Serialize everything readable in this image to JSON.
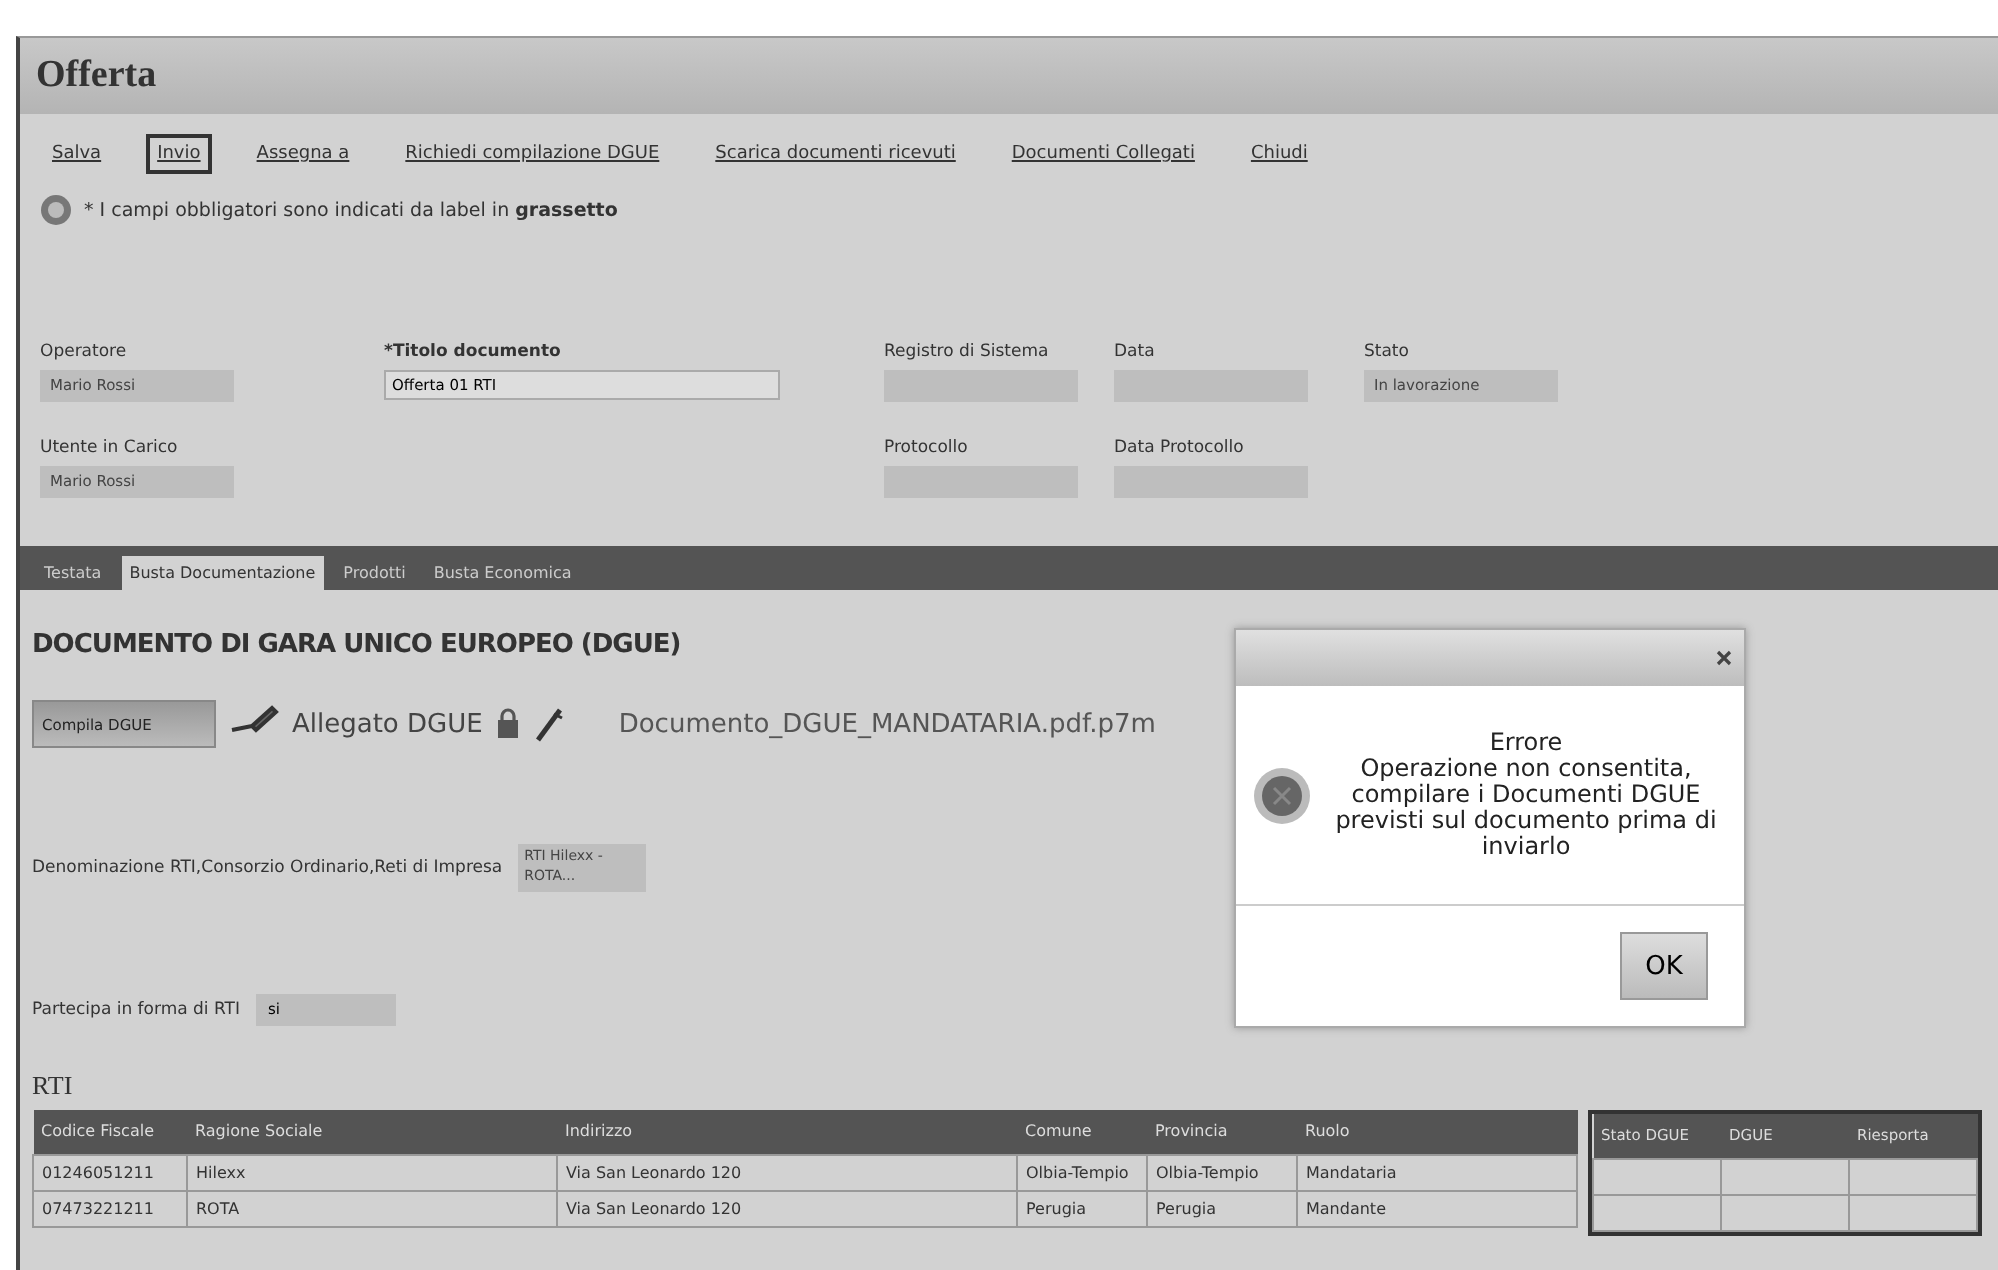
{
  "window": {
    "title": "Offerta"
  },
  "toolbar": [
    {
      "label": "Salva",
      "selected": false
    },
    {
      "label": "Invio",
      "selected": true
    },
    {
      "label": "Assegna a",
      "selected": false
    },
    {
      "label": "Richiedi compilazione DGUE",
      "selected": false
    },
    {
      "label": "Scarica documenti ricevuti",
      "selected": false
    },
    {
      "label": "Documenti Collegati",
      "selected": false
    },
    {
      "label": "Chiudi",
      "selected": false
    }
  ],
  "info": "* I campi obbligatori sono indicati da label in **grassetto**",
  "fields": [
    [
      {
        "label": "Operatore",
        "value": "Mario Rossi",
        "kind": "readonly",
        "required": false
      },
      {
        "label": "*Titolo documento",
        "value": "Offerta 01 RTI",
        "kind": "input",
        "required": true
      },
      {
        "label": "Registro di Sistema",
        "kind": "readonly",
        "required": false
      },
      {
        "label": "Data",
        "kind": "readonly",
        "required": false
      },
      {
        "label": "Stato",
        "value": "In lavorazione",
        "kind": "readonly",
        "required": false
      }
    ],
    [
      {
        "label": "Utente in Carico",
        "value": "Mario Rossi",
        "kind": "readonly",
        "required": false
      },
      {
        "kind": "blank"
      },
      {
        "label": "Protocollo",
        "kind": "readonly",
        "required": false
      },
      {
        "label": "Data Protocollo",
        "kind": "readonly",
        "required": false
      }
    ]
  ],
  "tabs": [
    {
      "label": "Testata",
      "selected": false
    },
    {
      "label": "Busta Documentazione",
      "selected": true
    },
    {
      "label": "Prodotti",
      "selected": false
    },
    {
      "label": "Busta Economica",
      "selected": false
    }
  ],
  "section_title": "DOCUMENTO DI GARA UNICO EUROPEO (DGUE)",
  "dgue": {
    "button": "Compila DGUE",
    "attachment_label": "Allegato DGUE",
    "file": "Documento_DGUE_MANDATARIA.pdf.p7m"
  },
  "denominazione": {
    "label": "Denominazione RTI,Consorzio Ordinario,Reti di Impresa",
    "value": "RTI Hilexx - ROTA..."
  },
  "partecipa": {
    "label": "Partecipa in forma di RTI",
    "value": "si"
  },
  "rti_title": "RTI",
  "table": {
    "columns": [
      "Codice Fiscale",
      "Ragione Sociale",
      "Indirizzo",
      "Comune",
      "Provincia",
      "Ruolo"
    ],
    "rows": [
      [
        "01246051211",
        "Hilexx",
        "Via San Leonardo 120",
        "Olbia-Tempio",
        "Olbia-Tempio",
        "Mandataria"
      ],
      [
        "07473221211",
        "ROTA",
        "Via San Leonardo 120",
        "Perugia",
        "Perugia",
        "Mandante"
      ]
    ],
    "extra_columns": [
      "Stato DGUE",
      "DGUE",
      "Riesporta"
    ]
  },
  "dialog": {
    "title": "Errore",
    "message": "Operazione non consentita, compilare i Documenti DGUE previsti sul documento prima di inviarlo",
    "button": "OK"
  }
}
